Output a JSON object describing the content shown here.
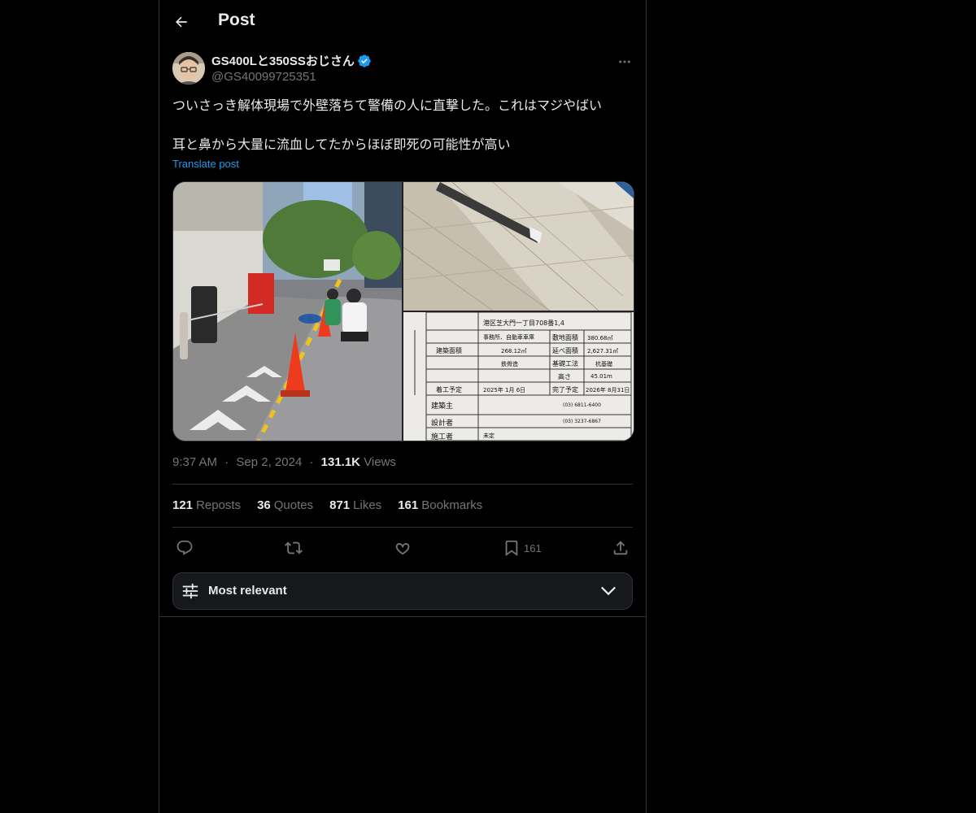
{
  "header": {
    "title": "Post",
    "back_icon": "arrow-left-icon"
  },
  "author": {
    "display_name": "GS400Lと350SSおじさん",
    "handle": "@GS40099725351",
    "verified": true,
    "verified_color": "#1d9bf0"
  },
  "tweet": {
    "lines": [
      "ついさっき解体現場で外壁落ちて警備の人に直撃した。これはマジやばい",
      "耳と鼻から大量に流血してたからほぼ即死の可能性が高い"
    ],
    "translate_label": "Translate post"
  },
  "sign_board": {
    "address": "港区芝大門一丁目708番1,4",
    "use": "事務所、自動車車庫",
    "site_area_label": "敷地面積",
    "site_area": "380.68㎡",
    "building_area_label": "建築面積",
    "building_area": "268.12㎡",
    "floor_area_label": "延べ面積",
    "floor_area": "2,627.31㎡",
    "structure": "鉄骨造",
    "foundation_label": "基礎工法",
    "foundation": "杭基礎",
    "height_label": "高さ",
    "height": "45.01m",
    "start_label": "着工予定",
    "start": "2025年 1月 6日",
    "finish_label": "完了予定",
    "finish": "2026年 8月31日",
    "owner_label": "建築主",
    "designer_label": "設計者",
    "contractor_label": "施工者",
    "contractor": "未定",
    "phone1": "(03) 6811-6400",
    "phone2": "(03) 3237-6867"
  },
  "meta": {
    "time": "9:37 AM",
    "date": "Sep 2, 2024",
    "views_count": "131.1K",
    "views_label": "Views",
    "separator": "·"
  },
  "stats": [
    {
      "count": "121",
      "label": "Reposts"
    },
    {
      "count": "36",
      "label": "Quotes"
    },
    {
      "count": "871",
      "label": "Likes"
    },
    {
      "count": "161",
      "label": "Bookmarks"
    }
  ],
  "actions": {
    "reply_icon": "reply-icon",
    "repost_icon": "repost-icon",
    "like_icon": "heart-icon",
    "bookmark_icon": "bookmark-icon",
    "bookmark_count": "161",
    "share_icon": "share-icon"
  },
  "sort": {
    "label": "Most relevant",
    "icon": "sliders-icon",
    "chevron": "chevron-down-icon"
  },
  "colors": {
    "background": "#000000",
    "text": "#e7e9ea",
    "secondary_text": "#71767b",
    "accent": "#1d9bf0",
    "border": "#2f3336"
  }
}
